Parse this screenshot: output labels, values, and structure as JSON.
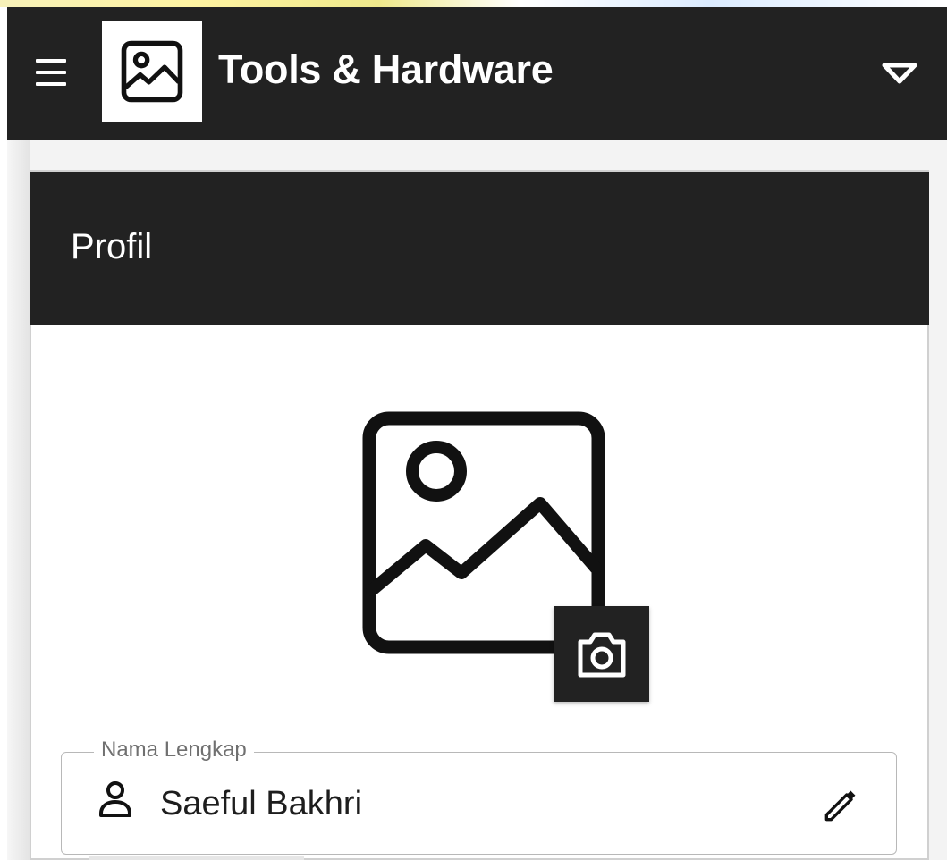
{
  "appbar": {
    "title": "Tools & Hardware",
    "menu_icon": "hamburger-menu-icon",
    "logo_icon": "image-placeholder-icon",
    "dropdown_icon": "triangle-down-icon"
  },
  "card": {
    "title": "Profil"
  },
  "profile": {
    "photo_icon": "image-placeholder-icon",
    "camera_icon": "camera-icon"
  },
  "form": {
    "full_name": {
      "label": "Nama Lengkap",
      "value": "Saeful Bakhri",
      "leading_icon": "person-icon",
      "trailing_icon": "pencil-edit-icon"
    }
  },
  "colors": {
    "bar": "#222222",
    "card": "#ffffff",
    "page": "#f3f3f3",
    "outline": "#b8b8b8"
  }
}
